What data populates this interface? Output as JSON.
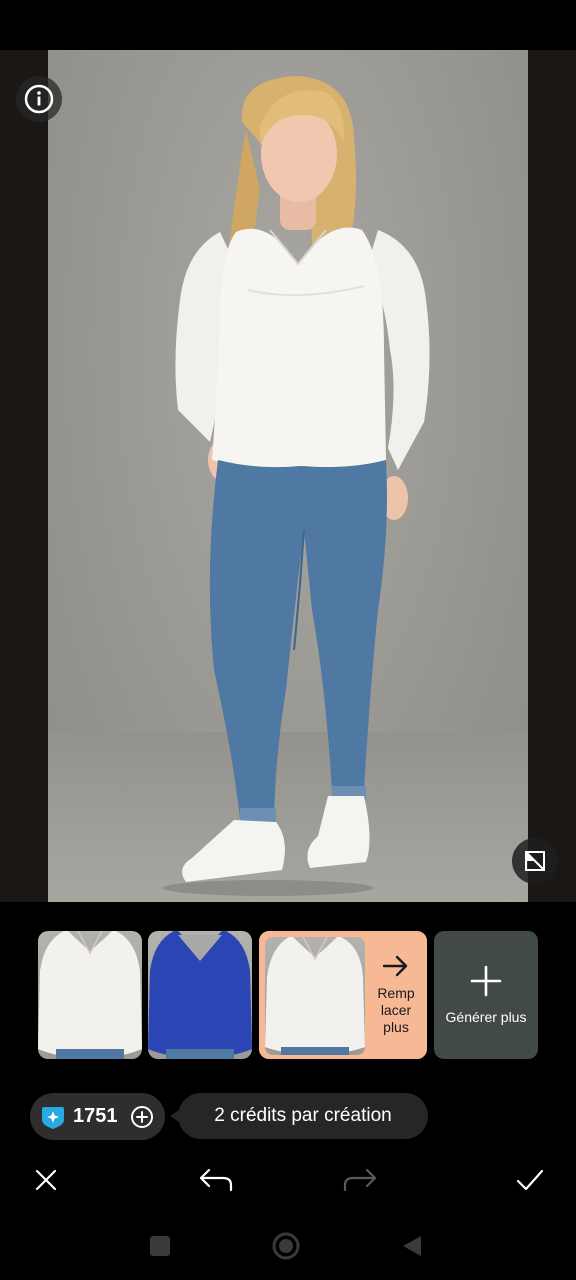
{
  "canvas": {
    "info_icon": "info-icon",
    "compare_icon": "compare-icon"
  },
  "variants": [
    {
      "name": "white-blouse",
      "color": "#f2f1ee"
    },
    {
      "name": "blue-blouse",
      "color": "#2b45b5"
    },
    {
      "name": "white-blouse-selected",
      "color": "#f2f1ee"
    }
  ],
  "replace": {
    "label": "Remp lacer plus",
    "icon": "arrow-right-icon"
  },
  "generate": {
    "label": "Générer plus",
    "icon": "plus-icon"
  },
  "credits": {
    "value": "1751",
    "info": "2 crédits par création",
    "icon": "sparkle-badge-icon",
    "add_icon": "plus-circle-icon"
  },
  "actions": {
    "close_icon": "close-icon",
    "undo_icon": "undo-icon",
    "redo_icon": "redo-icon",
    "confirm_icon": "check-icon"
  },
  "nav": {
    "recents_icon": "square-icon",
    "home_icon": "circle-icon",
    "back_icon": "triangle-icon"
  },
  "colors": {
    "accent": "#f7b896",
    "generate_bg": "#424a48",
    "badge": "#29a9e1"
  }
}
